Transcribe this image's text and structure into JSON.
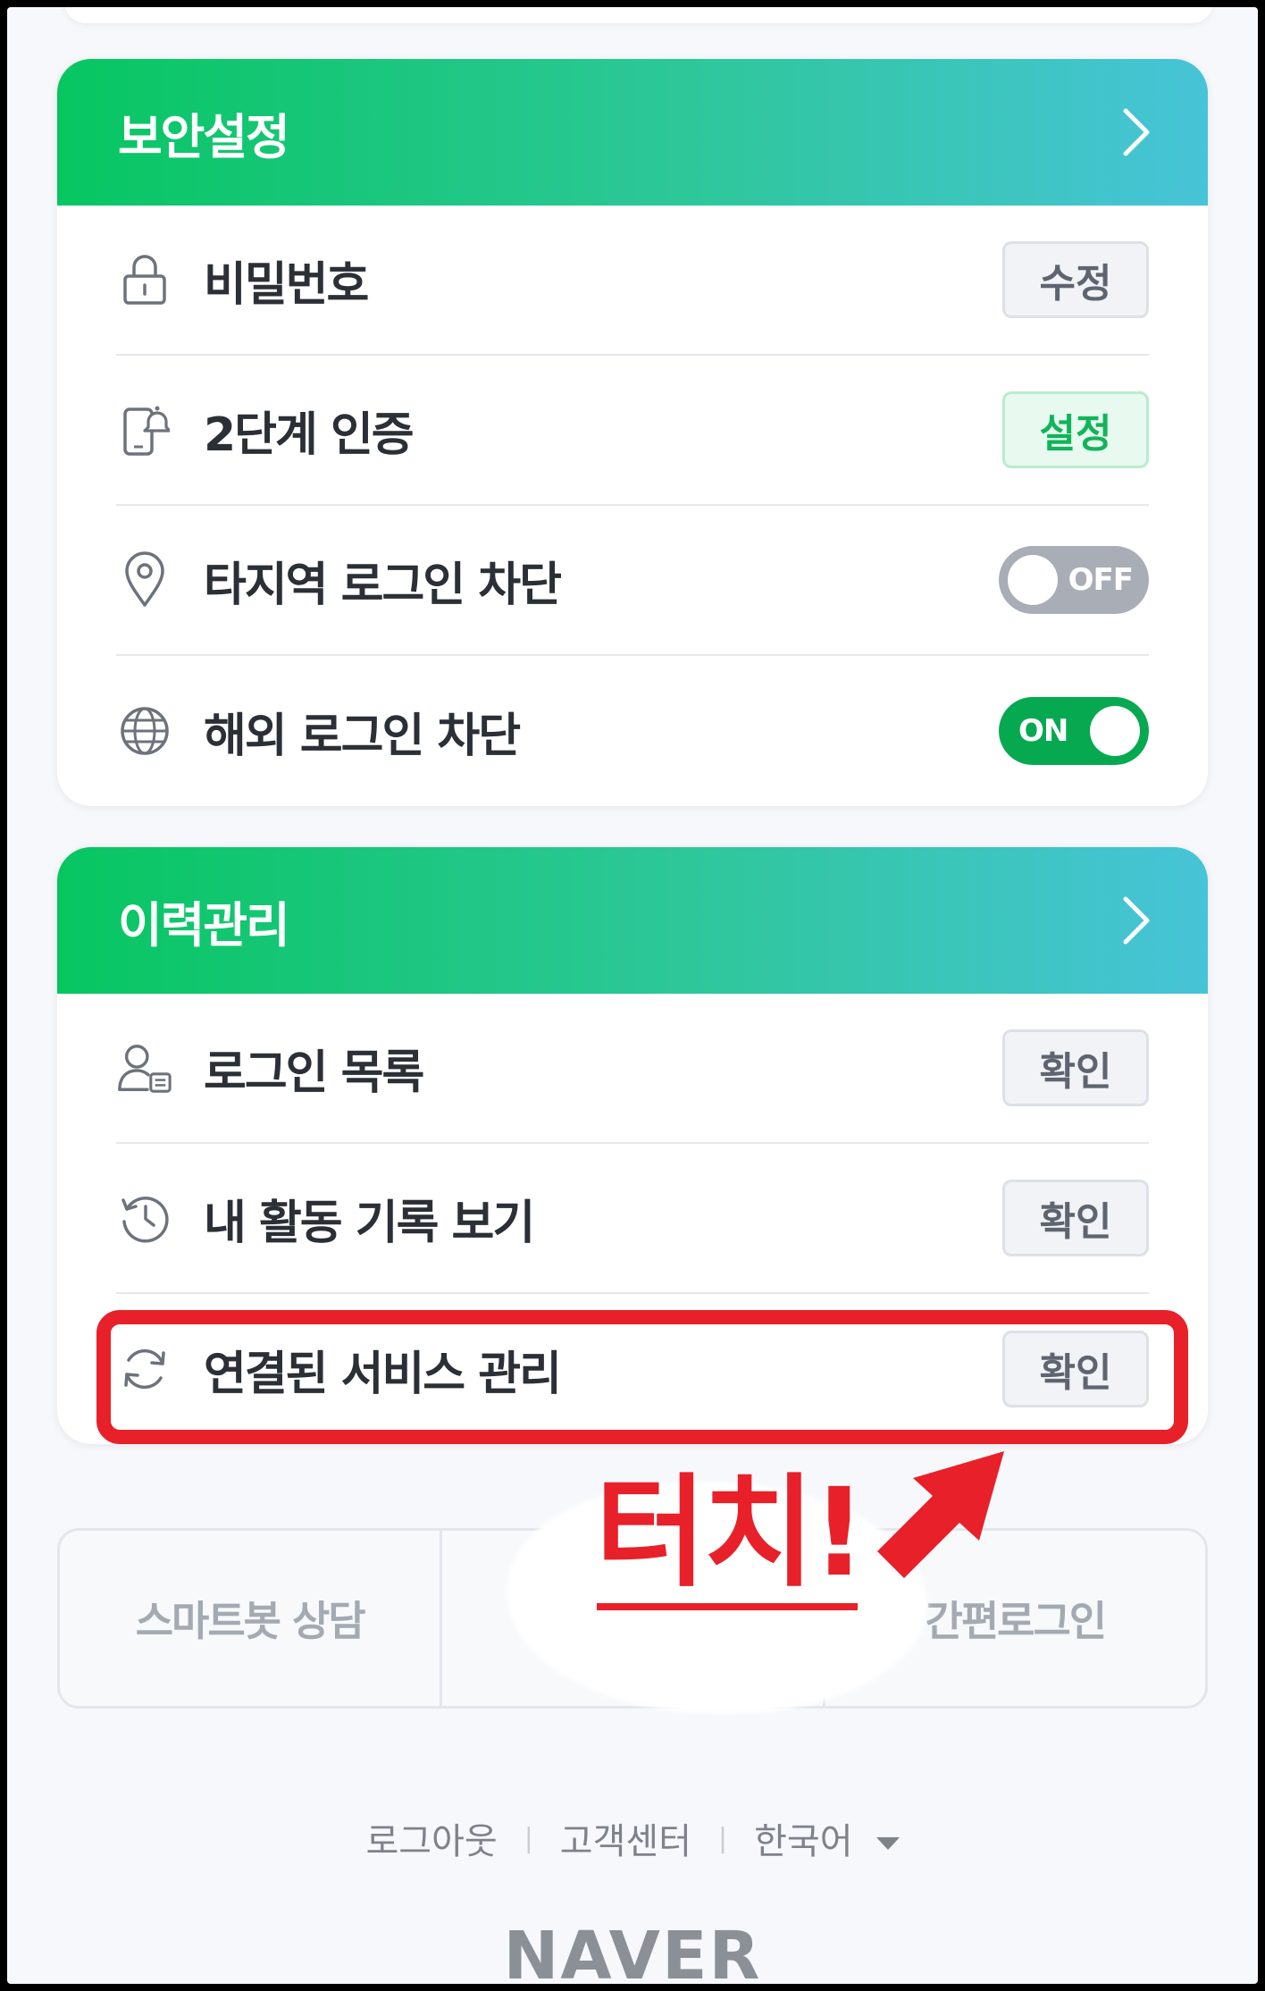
{
  "security_card": {
    "title": "보안설정",
    "rows": [
      {
        "label": "비밀번호",
        "action": "수정"
      },
      {
        "label": "2단계 인증",
        "action": "설정"
      },
      {
        "label": "타지역 로그인 차단",
        "toggle": "OFF"
      },
      {
        "label": "해외 로그인 차단",
        "toggle": "ON"
      }
    ]
  },
  "history_card": {
    "title": "이력관리",
    "rows": [
      {
        "label": "로그인 목록",
        "action": "확인"
      },
      {
        "label": "내 활동 기록 보기",
        "action": "확인"
      },
      {
        "label": "연결된 서비스 관리",
        "action": "확인"
      }
    ]
  },
  "annotation": {
    "callout": "터치!",
    "color": "#e8202a"
  },
  "bottom_bar": {
    "left": "스마트봇 상담",
    "right": "간편로그인"
  },
  "footer": {
    "logout": "로그아웃",
    "support": "고객센터",
    "language": "한국어"
  },
  "brand": {
    "logo": "NAVER",
    "accent": "#07c661",
    "accent_end": "#47c4d8"
  },
  "icons": [
    "chevron-right-icon",
    "lock-icon",
    "phone-bell-icon",
    "location-pin-icon",
    "globe-icon",
    "user-list-icon",
    "history-icon",
    "refresh-icon",
    "caret-down-icon"
  ]
}
